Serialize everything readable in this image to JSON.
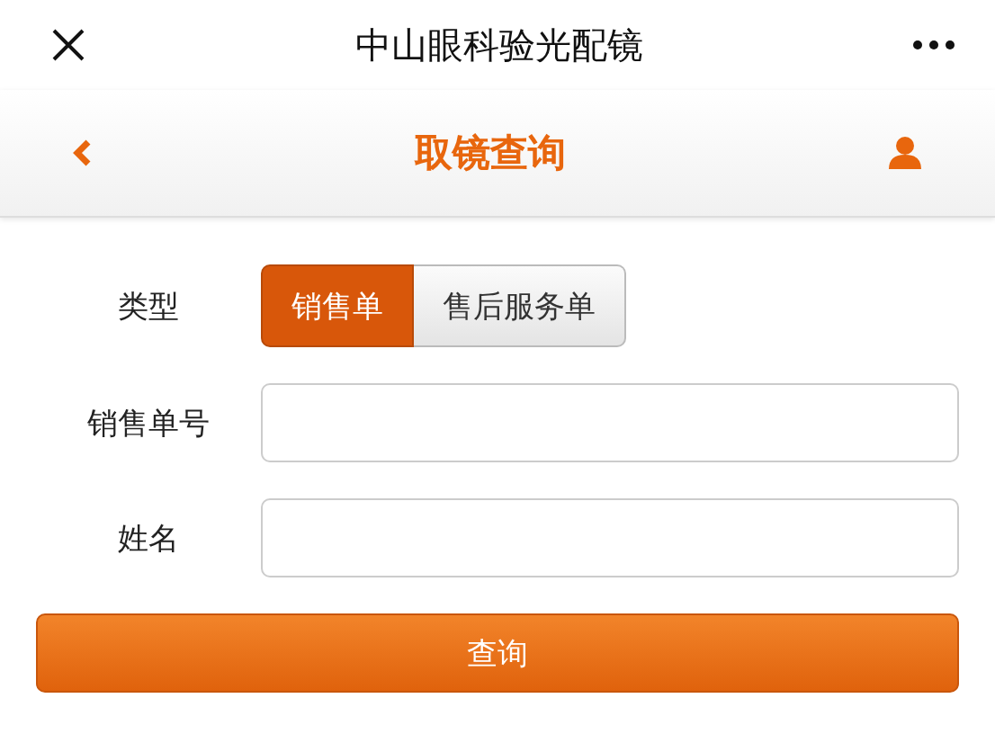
{
  "window": {
    "title": "中山眼科验光配镜"
  },
  "header": {
    "title": "取镜查询"
  },
  "type_row": {
    "label": "类型",
    "options": [
      {
        "label": "销售单",
        "selected": true
      },
      {
        "label": "售后服务单",
        "selected": false
      }
    ]
  },
  "fields": [
    {
      "label": "销售单号"
    },
    {
      "label": "姓名"
    }
  ],
  "submit": {
    "label": "查询"
  }
}
